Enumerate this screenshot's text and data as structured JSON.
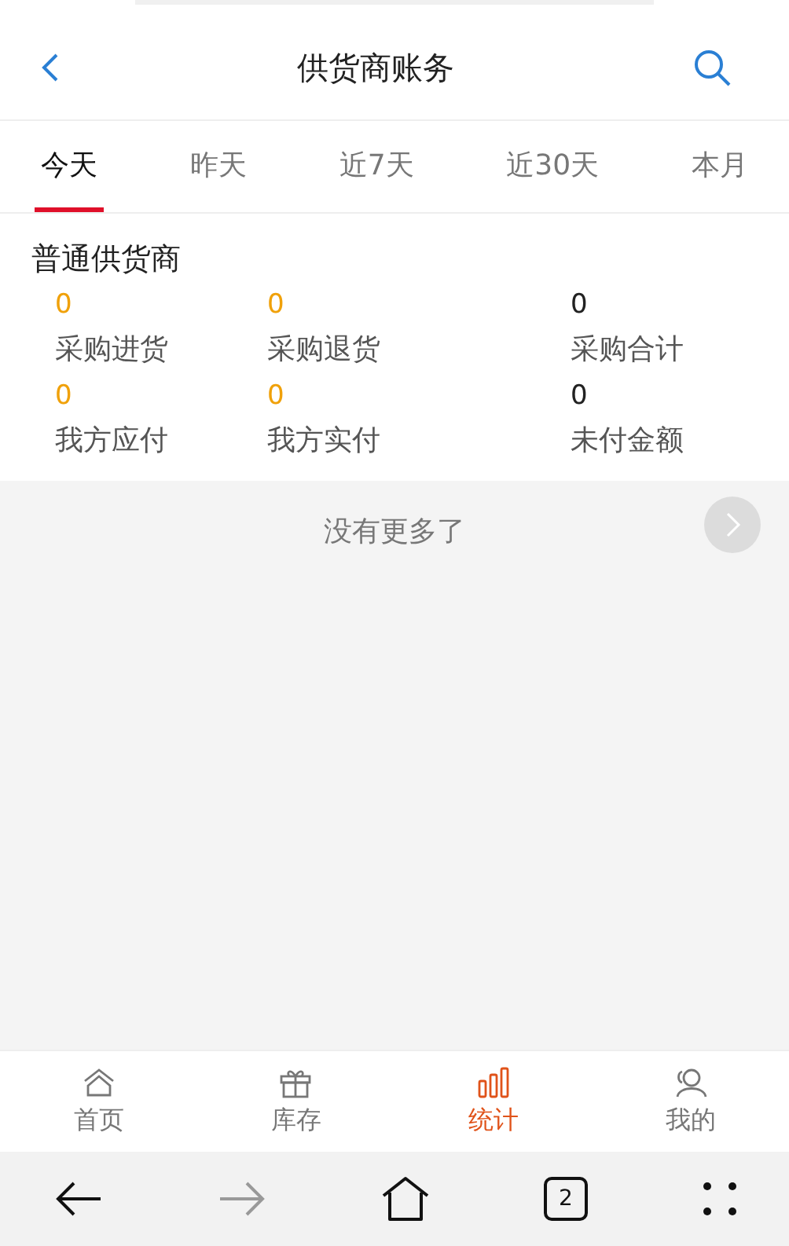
{
  "header": {
    "title": "供货商账务"
  },
  "tabs": [
    {
      "label": "今天",
      "selected": true
    },
    {
      "label": "昨天",
      "selected": false
    },
    {
      "label": "近7天",
      "selected": false
    },
    {
      "label": "近30天",
      "selected": false
    },
    {
      "label": "本月",
      "selected": false
    }
  ],
  "section": {
    "title": "普通供货商",
    "stats": [
      {
        "value": "0",
        "label": "采购进货",
        "highlight": true
      },
      {
        "value": "0",
        "label": "采购退货",
        "highlight": true
      },
      {
        "value": "0",
        "label": "采购合计",
        "highlight": false
      },
      {
        "value": "0",
        "label": "我方应付",
        "highlight": true
      },
      {
        "value": "0",
        "label": "我方实付",
        "highlight": true
      },
      {
        "value": "0",
        "label": "未付金额",
        "highlight": false
      }
    ]
  },
  "end_text": "没有更多了",
  "tab_bar": [
    {
      "kind": "home",
      "label": "首页",
      "selected": false
    },
    {
      "kind": "gift",
      "label": "库存",
      "selected": false
    },
    {
      "kind": "chart",
      "label": "统计",
      "selected": true
    },
    {
      "kind": "user",
      "label": "我的",
      "selected": false
    }
  ],
  "browser_bar": {
    "forward_disabled": true,
    "tab_count": "2"
  }
}
